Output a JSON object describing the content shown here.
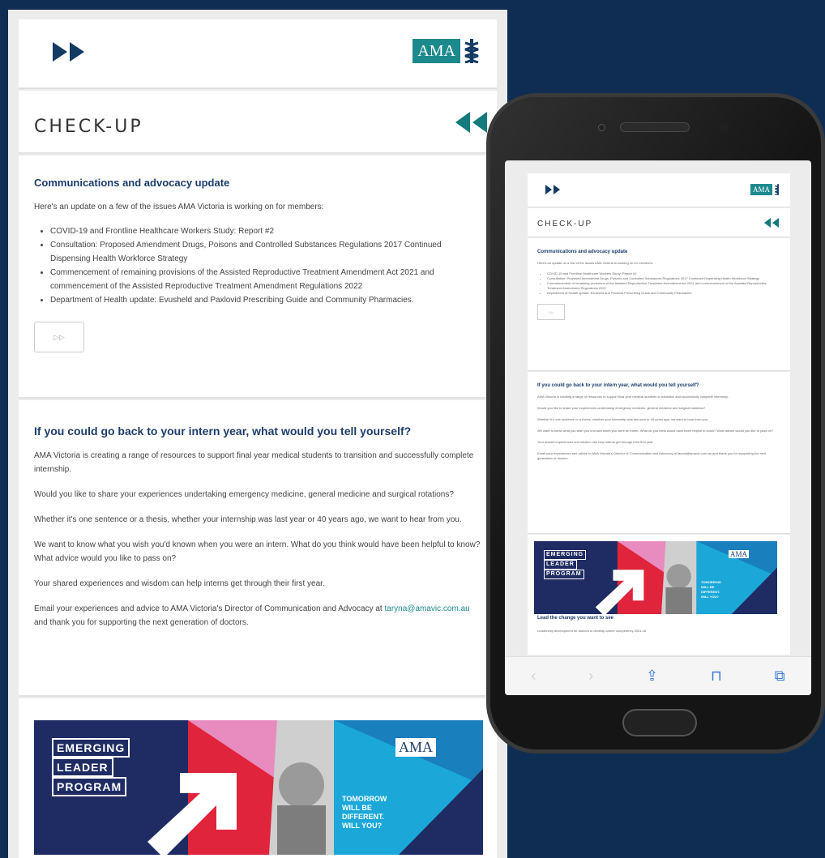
{
  "desktop": {
    "logo_text": "AMA",
    "section_title": "CHECK-UP",
    "article1": {
      "heading": "Communications and advocacy update",
      "intro": "Here's an update on a few of the issues AMA Victoria is working on for members:",
      "bullets": [
        "COVID-19 and Frontline Healthcare Workers Study: Report #2",
        "Consultation: Proposed Amendment Drugs, Poisons and Controlled Substances Regulations 2017 Continued Dispensing Health Workforce Strategy",
        "Commencement of remaining provisions of the Assisted Reproductive Treatment Amendment Act 2021 and commencement of the Assisted Reproductive Treatment Amendment Regulations 2022",
        "Department of Health update: Evusheld and Paxlovid Prescribing Guide and Community Pharmacies."
      ],
      "cta": "▷▷"
    },
    "article2": {
      "heading": "If you could go back to your intern year, what would you tell yourself?",
      "p1": "AMA Victoria is creating a range of resources to support final year medical students to transition and successfully complete internship.",
      "p2": "Would you like to share your experiences undertaking emergency medicine, general medicine and surgical rotations?",
      "p3": "Whether it's one sentence or a thesis, whether your internship was last year or 40 years ago, we want to hear from you.",
      "p4": "We want to know what you wish you'd known when you were an intern. What do you think would have been helpful to know? What advice would you like to pass on?",
      "p5": "Your shared experiences and wisdom can help interns get through their first year.",
      "p6_start": "Email your experiences and advice to AMA Victoria's Director of Communication and Advocacy at",
      "p6_link": "taryna@amavic.com.au",
      "p6_end": "and thank you for supporting the next generation of doctors."
    },
    "banner": {
      "line1": "EMERGING",
      "line2": "LEADER",
      "line3": "PROGRAM",
      "logo_text": "AMA",
      "tagline1": "TOMORROW",
      "tagline2": "WILL BE",
      "tagline3": "DIFFERENT.",
      "tagline4": "WILL YOU?"
    }
  },
  "mobile": {
    "logo_text": "AMA",
    "section_title": "CHECK-UP",
    "article1_heading": "Communications and advocacy update",
    "article1_intro": "Here's an update on a few of the issues AMA Victoria is working on for members:",
    "article1_bullets": [
      "COVID-19 and Frontline Healthcare Workers Study: Report #2",
      "Consultation: Proposed Amendment Drugs, Poisons and Controlled Substances Regulations 2017 Continued Dispensing Health Workforce Strategy",
      "Commencement of remaining provisions of the Assisted Reproductive Treatment Amendment Act 2021 and commencement of the Assisted Reproductive Treatment Amendment Regulations 2022",
      "Department of Health update: Evusheld and Paxlovid Prescribing Guide and Community Pharmacies."
    ],
    "cta": "▷▷",
    "article2_heading": "If you could go back to your intern year, what would you tell yourself?",
    "article2_p1": "AMA Victoria is creating a range of resources to support final year medical students to transition and successfully complete internship.",
    "article2_p2": "Would you like to share your experiences undertaking emergency medicine, general medicine and surgical rotations?",
    "article2_p3": "Whether it's one sentence or a thesis, whether your internship was last year or 40 years ago, we want to hear from you.",
    "article2_p4": "We want to know what you wish you'd known when you were an intern. What do you think would have been helpful to know? What advice would you like to pass on?",
    "article2_p5": "Your shared experiences and wisdom can help interns get through their first year.",
    "article2_p6": "Email your experiences and advice to AMA Victoria's Director of Communication and Advocacy at taryna@amavic.com.au and thank you for supporting the next generation of doctors.",
    "banner_line1": "EMERGING",
    "banner_line2": "LEADER",
    "banner_line3": "PROGRAM",
    "banner_logo": "AMA",
    "banner_tag1": "TOMORROW",
    "banner_tag2": "WILL BE",
    "banner_tag3": "DIFFERENT.",
    "banner_tag4": "WILL YOU?",
    "article3_heading": "Lead the change you want to see",
    "article3_p": "Leadership development for doctors to develop career competency 2021-18",
    "toolbar": {
      "back": "‹",
      "forward": "›",
      "share": "⇪",
      "bookmarks": "⊓",
      "tabs": "⧉"
    }
  },
  "colors": {
    "background": "#0f2d52",
    "navy": "#133a63",
    "teal": "#1c8a8d",
    "heading": "#1c3d6b",
    "banner_pink": "#e88cc0",
    "banner_red": "#e0243b",
    "banner_cyan": "#1ba8d9",
    "banner_navy": "#1f2c63"
  }
}
